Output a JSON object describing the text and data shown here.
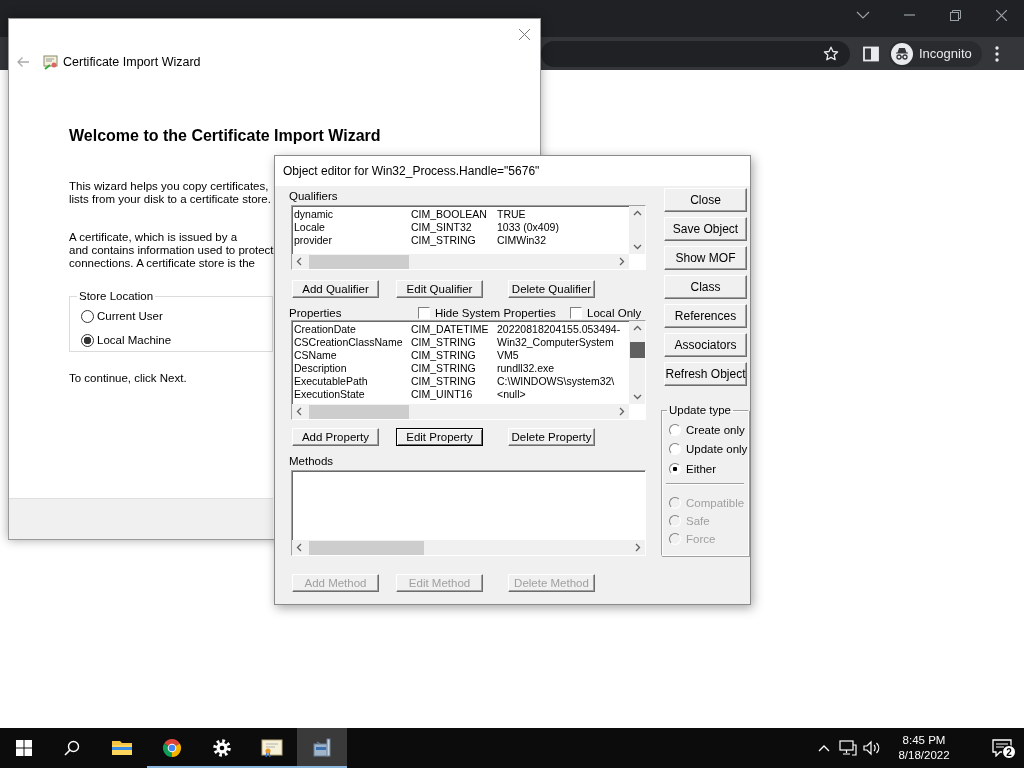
{
  "browser": {
    "profile_label": "Incognito"
  },
  "wizard": {
    "title": "Certificate Import Wizard",
    "heading": "Welcome to the Certificate Import Wizard",
    "paragraphs": [
      [
        "This wizard helps you copy certificates,",
        "lists from your disk to a certificate store."
      ],
      [
        "A certificate, which is issued by a",
        "and contains information used to protect",
        "connections. A certificate store is the"
      ]
    ],
    "store_location": {
      "legend": "Store Location",
      "options": [
        {
          "label": "Current User",
          "selected": false
        },
        {
          "label": "Local Machine",
          "selected": true
        }
      ]
    },
    "footer_text": "To continue, click Next."
  },
  "object_editor": {
    "title": "Object editor for Win32_Process.Handle=\"5676\"",
    "qualifiers": {
      "label": "Qualifiers",
      "rows": [
        {
          "name": "dynamic",
          "type": "CIM_BOOLEAN",
          "value": "TRUE"
        },
        {
          "name": "Locale",
          "type": "CIM_SINT32",
          "value": "1033 (0x409)"
        },
        {
          "name": "provider",
          "type": "CIM_STRING",
          "value": "CIMWin32"
        }
      ]
    },
    "qualifier_buttons": [
      {
        "label": "Add Qualifier",
        "disabled": false,
        "focused": false
      },
      {
        "label": "Edit Qualifier",
        "disabled": false,
        "focused": false
      },
      {
        "label": "Delete Qualifier",
        "disabled": false,
        "focused": false
      }
    ],
    "properties": {
      "label": "Properties",
      "options": [
        {
          "label": "Hide System Properties",
          "checked": false
        },
        {
          "label": "Local Only",
          "checked": false
        }
      ],
      "rows": [
        {
          "name": "CreationDate",
          "type": "CIM_DATETIME",
          "value": "20220818204155.053494-"
        },
        {
          "name": "CSCreationClassName",
          "type": "CIM_STRING",
          "value": "Win32_ComputerSystem"
        },
        {
          "name": "CSName",
          "type": "CIM_STRING",
          "value": "VM5"
        },
        {
          "name": "Description",
          "type": "CIM_STRING",
          "value": "rundll32.exe"
        },
        {
          "name": "ExecutablePath",
          "type": "CIM_STRING",
          "value": "C:\\WINDOWS\\system32\\"
        },
        {
          "name": "ExecutionState",
          "type": "CIM_UINT16",
          "value": "<null>"
        }
      ]
    },
    "property_buttons": [
      {
        "label": "Add Property",
        "disabled": false,
        "focused": false
      },
      {
        "label": "Edit Property",
        "disabled": false,
        "focused": true
      },
      {
        "label": "Delete Property",
        "disabled": false,
        "focused": false
      }
    ],
    "methods": {
      "label": "Methods"
    },
    "method_buttons": [
      {
        "label": "Add Method",
        "disabled": true,
        "focused": false
      },
      {
        "label": "Edit Method",
        "disabled": true,
        "focused": false
      },
      {
        "label": "Delete Method",
        "disabled": true,
        "focused": false
      }
    ],
    "side_buttons": [
      "Close",
      "Save Object",
      "Show MOF",
      "Class",
      "References",
      "Associators",
      "Refresh Object"
    ],
    "update_type": {
      "legend": "Update type",
      "modes": [
        {
          "label": "Create only",
          "selected": false,
          "disabled": false
        },
        {
          "label": "Update only",
          "selected": false,
          "disabled": false
        },
        {
          "label": "Either",
          "selected": true,
          "disabled": false
        }
      ],
      "flags": [
        {
          "label": "Compatible",
          "selected": false,
          "disabled": true
        },
        {
          "label": "Safe",
          "selected": false,
          "disabled": true
        },
        {
          "label": "Force",
          "selected": false,
          "disabled": true
        }
      ]
    }
  },
  "taskbar": {
    "apps": [
      {
        "kind": "explorer",
        "running": false,
        "active": false
      },
      {
        "kind": "chrome",
        "running": true,
        "active": false
      },
      {
        "kind": "settings",
        "running": true,
        "active": false
      },
      {
        "kind": "certificate",
        "running": true,
        "active": false
      },
      {
        "kind": "wmi",
        "running": true,
        "active": true
      }
    ],
    "time": "8:45 PM",
    "date": "8/18/2022",
    "notification_count": "2"
  }
}
